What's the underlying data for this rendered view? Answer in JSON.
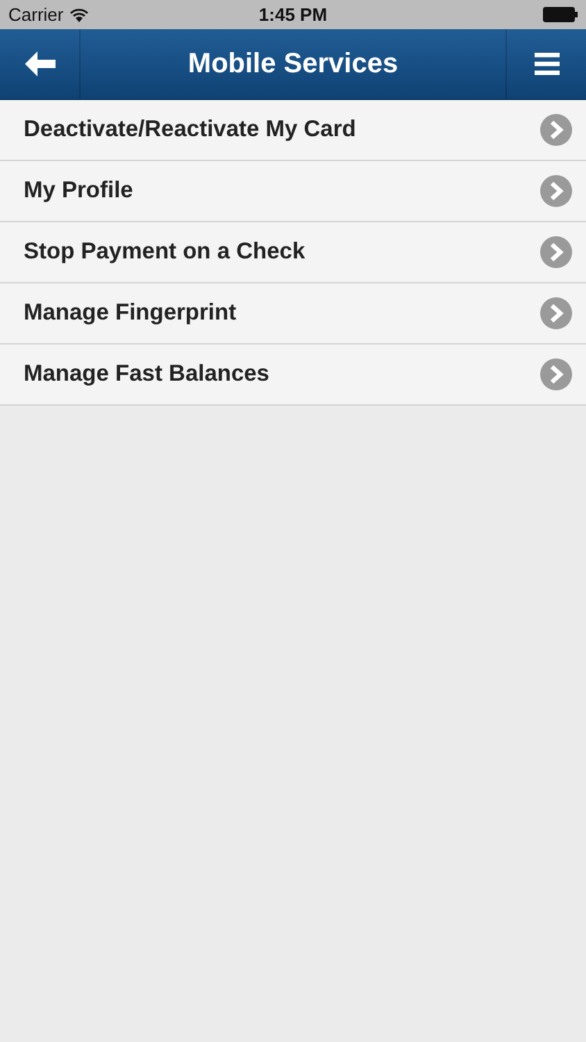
{
  "status_bar": {
    "carrier": "Carrier",
    "time": "1:45 PM"
  },
  "nav_bar": {
    "title": "Mobile Services"
  },
  "menu_items": [
    {
      "label": "Deactivate/Reactivate My Card"
    },
    {
      "label": "My Profile"
    },
    {
      "label": "Stop Payment on a Check"
    },
    {
      "label": "Manage Fingerprint"
    },
    {
      "label": "Manage Fast Balances"
    }
  ]
}
